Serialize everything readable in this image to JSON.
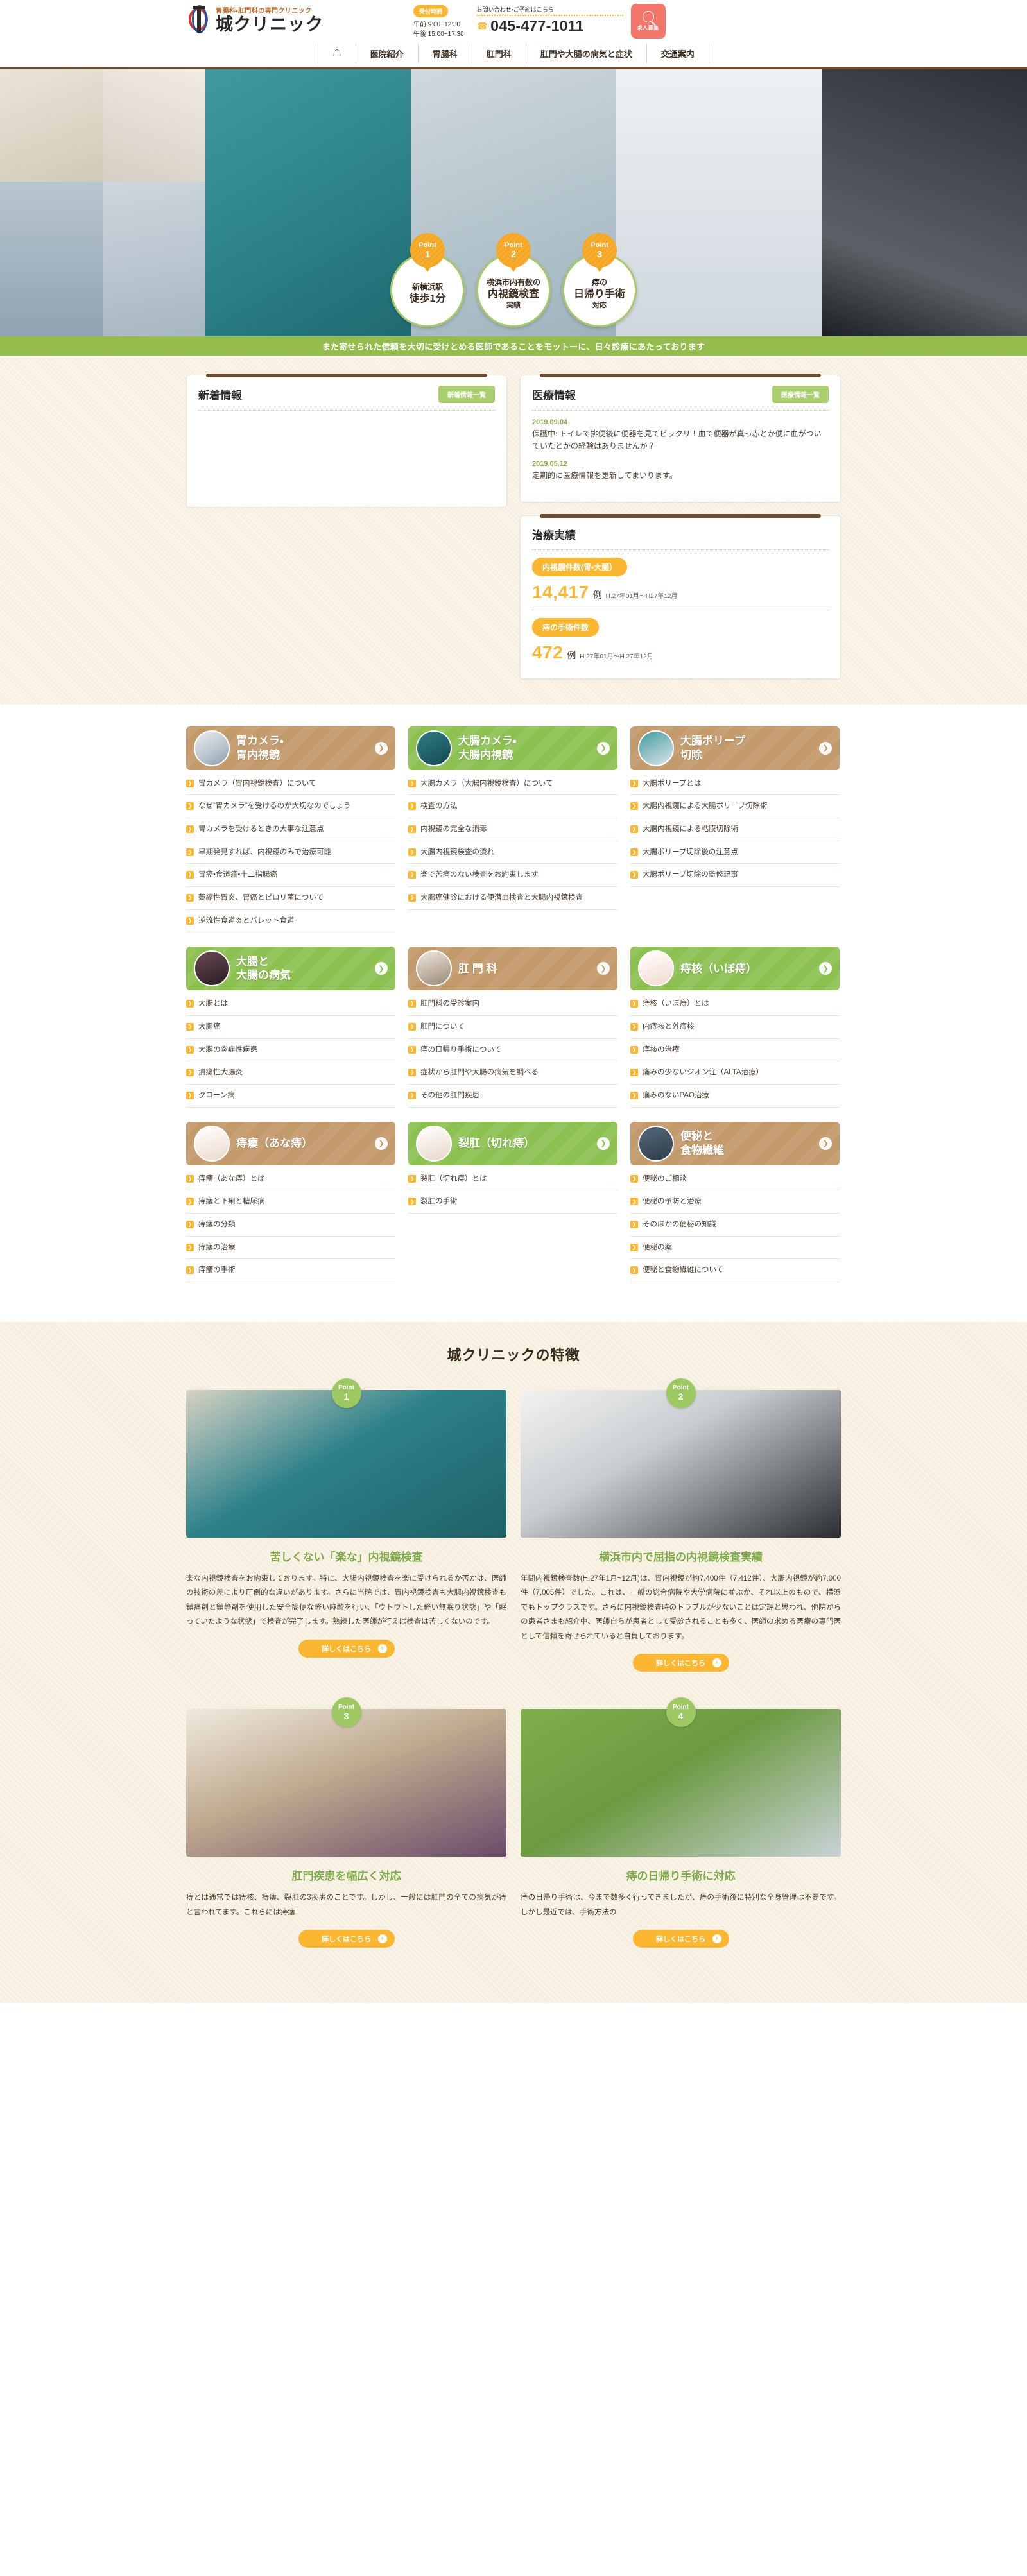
{
  "header": {
    "logo_tagline": "胃腸科・肛門科の専門クリニック",
    "logo_name": "城クリニック",
    "hours_badge": "受付時間",
    "hours_am": "午前  9:00~12:30",
    "hours_pm": "午後  15:00~17:30",
    "contact_label": "お問い合わせ・ご予約はこちら",
    "phone": "045-477-1011",
    "recruit_label": "求人募集",
    "phone_icon": "phone-icon",
    "recruit_icon": "magnifier-person-icon"
  },
  "nav": {
    "home_icon": "home-icon",
    "items": [
      {
        "label": "医院紹介"
      },
      {
        "label": "胃腸科"
      },
      {
        "label": "肛門科"
      },
      {
        "label": "肛門や大腸の病気と症状"
      },
      {
        "label": "交通案内"
      }
    ]
  },
  "hero": {
    "points": [
      {
        "word": "Point",
        "num": "1",
        "l1": "新横浜駅",
        "l2": "徒歩1分",
        "l3": ""
      },
      {
        "word": "Point",
        "num": "2",
        "l1": "横浜市内有数の",
        "l2": "内視鏡検査",
        "l3": "実績"
      },
      {
        "word": "Point",
        "num": "3",
        "l1": "痔の",
        "l2": "日帰り手術",
        "l3": "対応"
      }
    ]
  },
  "motto": "また寄せられた信頼を大切に受けとめる医師であることをモットーに、日々診療にあたっております",
  "news": {
    "title": "新着情報",
    "button": "新着情報一覧",
    "items": []
  },
  "medical_info": {
    "title": "医療情報",
    "button": "医療情報一覧",
    "items": [
      {
        "date": "2019.09.04",
        "text": "保護中: トイレで排便後に便器を見てビックリ！血で便器が真っ赤とか便に血がついていたとかの経験はありませんか？"
      },
      {
        "date": "2019.05.12",
        "text": "定期的に医療情報を更新してまいります。"
      }
    ]
  },
  "results": {
    "title": "治療実績",
    "stats": [
      {
        "pill": "内視鏡件数(胃・大腸）",
        "number": "14,417",
        "unit": "例",
        "period": "H.27年01月～H27年12月"
      },
      {
        "pill": "痔の手術件数",
        "number": "472",
        "unit": "例",
        "period": "H.27年01月～H.27年12月"
      }
    ]
  },
  "menu_cards": [
    {
      "title": "胃カメラ・\n胃内視鏡",
      "color": "brown",
      "thumb": "thumb-scope",
      "thumb_icon": "endoscope-machine-icon",
      "items": [
        "胃カメラ（胃内視鏡検査）について",
        "なぜ”胃カメラ”を受けるのが大切なのでしょう",
        "胃カメラを受けるときの大事な注意点",
        "早期発見すれば、内視鏡のみで治療可能",
        "胃癌・食道癌・十二指腸癌",
        "萎縮性胃炎、胃癌とピロリ菌について",
        "逆流性食道炎とバレット食道"
      ]
    },
    {
      "title": "大腸カメラ・\n大腸内視鏡",
      "color": "green",
      "thumb": "thumb-hand",
      "thumb_icon": "gloved-hand-scope-icon",
      "items": [
        "大腸カメラ（大腸内視鏡検査）について",
        "検査の方法",
        "内視鏡の完全な消毒",
        "大腸内視鏡検査の流れ",
        "楽で苦痛のない検査をお約束します",
        "大腸癌健診における便潜血検査と大腸内視鏡検査"
      ]
    },
    {
      "title": "大腸ポリープ\n切除",
      "color": "brown",
      "thumb": "thumb-polyp",
      "thumb_icon": "doctor-procedure-icon",
      "items": [
        "大腸ポリープとは",
        "大腸内視鏡による大腸ポリープ切除術",
        "大腸内視鏡による粘膜切除術",
        "大腸ポリープ切除後の注意点",
        "大腸ポリープ切除の監修記事"
      ]
    },
    {
      "title": "大腸と\n大腸の病気",
      "color": "green",
      "thumb": "thumb-colon",
      "thumb_icon": "colon-scope-image-icon",
      "items": [
        "大腸とは",
        "大腸癌",
        "大腸の炎症性疾患",
        "潰瘍性大腸炎",
        "クローン病"
      ]
    },
    {
      "title": "肛 門 科",
      "color": "brown",
      "thumb": "thumb-room",
      "thumb_icon": "exam-room-icon",
      "items": [
        "肛門科の受診案内",
        "肛門について",
        "痔の日帰り手術について",
        "症状から肛門や大腸の病気を調べる",
        "その他の肛門疾患"
      ]
    },
    {
      "title": "痔核（いぼ痔）",
      "color": "green",
      "thumb": "thumb-diag",
      "thumb_icon": "anatomy-diagram-icon",
      "items": [
        "痔核（いぼ痔）とは",
        "内痔核と外痔核",
        "痔核の治療",
        "痛みの少ないジオン注（ALTA治療）",
        "痛みのないPAO治療"
      ]
    },
    {
      "title": "痔瘻（あな痔）",
      "color": "brown",
      "thumb": "thumb-diag2",
      "thumb_icon": "anatomy-diagram-icon",
      "items": [
        "痔瘻（あな痔）とは",
        "痔瘻と下痢と糖尿病",
        "痔瘻の分類",
        "痔瘻の治療",
        "痔瘻の手術"
      ]
    },
    {
      "title": "裂肛（切れ痔）",
      "color": "green",
      "thumb": "thumb-diag3",
      "thumb_icon": "anatomy-diagram-icon",
      "items": [
        "裂肛（切れ痔）とは",
        "裂肛の手術"
      ]
    },
    {
      "title": "便秘と\n食物繊維",
      "color": "brown",
      "thumb": "thumb-person",
      "thumb_icon": "person-abdomen-icon",
      "items": [
        "便秘のご相談",
        "便秘の予防と治療",
        "そのほかの便秘の知識",
        "便秘の薬",
        "便秘と食物繊維について"
      ]
    }
  ],
  "features": {
    "heading": "城クリニックの特徴",
    "more_label": "詳しくはこちら",
    "cards": [
      {
        "point_word": "Point",
        "point_num": "1",
        "img": "fimg1",
        "img_alt": "doctor-endoscopy-photo",
        "title": "苦しくない「楽な」内視鏡検査",
        "body": "楽な内視鏡検査をお約束しております。特に、大腸内視鏡検査を楽に受けられるか否かは、医師の技術の差により圧倒的な違いがあります。さらに当院では、胃内視鏡検査も大腸内視鏡検査も鎮痛剤と鎮静剤を使用した安全簡便な軽い麻酔を行い、「ウトウトした軽い無眠り状態」や「眠っていたような状態」で検査が完了します。熟練した医師が行えば検査は苦しくないのです。"
      },
      {
        "point_word": "Point",
        "point_num": "2",
        "img": "fimg2",
        "img_alt": "endoscope-equipment-photo",
        "title": "横浜市内で屈指の内視鏡検査実績",
        "body": "年間内視鏡検査数(H.27年1月~12月)は、胃内視鏡が約7,400件（7,412件）、大腸内視鏡が約7,000件（7,005件）でした。これは、一般の総合病院や大学病院に並ぶか、それ以上のもので、横浜でもトップクラスです。さらに内視鏡検査時のトラブルが少ないことは定評と思われ、他院からの患者さまも紹介中、医師自らが患者として受診されることも多く、医師の求める医療の専門医として信頼を寄せられていると自負しております。"
      },
      {
        "point_word": "Point",
        "point_num": "3",
        "img": "fimg3",
        "img_alt": "exam-bed-photo",
        "title": "肛門疾患を幅広く対応",
        "body": "痔とは通常では痔核、痔瘻、裂肛の3疾患のことです。しかし、一般には肛門の全ての病気が痔と言われてます。これらには痔瘻"
      },
      {
        "point_word": "Point",
        "point_num": "4",
        "img": "fimg4",
        "img_alt": "surgical-instruments-photo",
        "title": "痔の日帰り手術に対応",
        "body": "痔の日帰り手術は、今まで数多く行ってきましたが、痔の手術後に特別な全身管理は不要です。しかし最近では、手術方法の"
      }
    ]
  }
}
